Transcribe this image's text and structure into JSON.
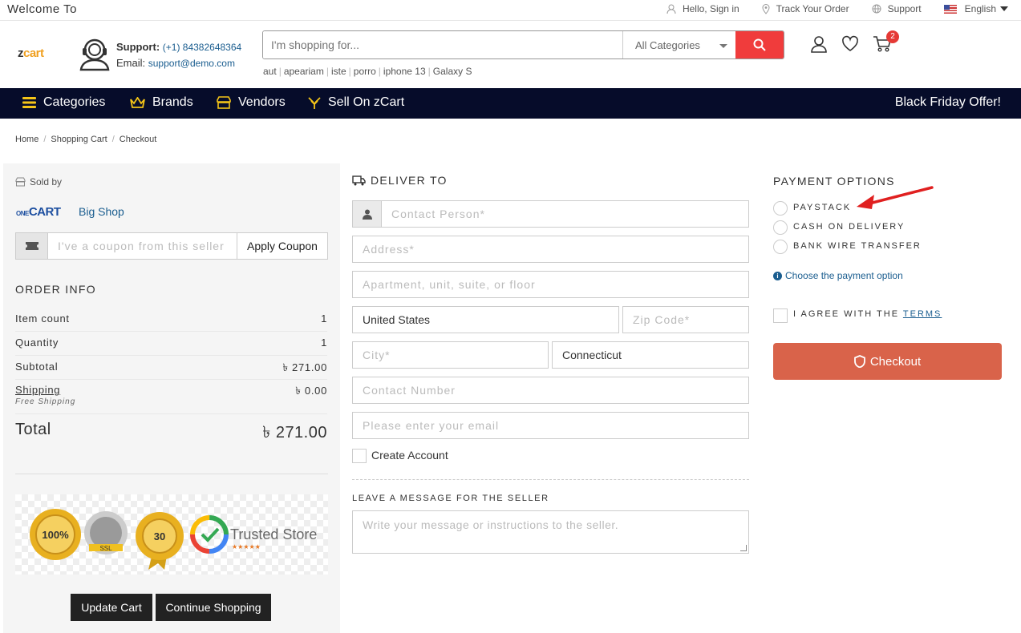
{
  "topbar": {
    "welcome": "Welcome To",
    "links": [
      "Hello, Sign in",
      "Track Your Order",
      "Support"
    ],
    "language": "English"
  },
  "header": {
    "logo_prefix": "z",
    "logo_suffix": "cart",
    "support_label": "Support:",
    "support_phone": "(+1) 84382648364",
    "email_label": "Email:",
    "email": "support@demo.com",
    "search_placeholder": "I'm shopping for...",
    "search_category": "All Categories",
    "search_tags": [
      "aut",
      "apeariam",
      "iste",
      "porro",
      "iphone 13",
      "Galaxy S"
    ],
    "cart_count": "2"
  },
  "nav": {
    "items": [
      "Categories",
      "Brands",
      "Vendors",
      "Sell On zCart"
    ],
    "offer": "Black Friday Offer!"
  },
  "breadcrumb": [
    "Home",
    "Shopping Cart",
    "Checkout"
  ],
  "cart": {
    "sold_by": "Sold by",
    "shop_logo_prefix": "ONE",
    "shop_logo_suffix": "CART",
    "shop_name": "Big Shop",
    "coupon_placeholder": "I've a coupon from this seller",
    "apply_coupon": "Apply Coupon",
    "order_info_title": "ORDER INFO",
    "rows": {
      "item_count_label": "Item count",
      "item_count": "1",
      "quantity_label": "Quantity",
      "quantity": "1",
      "subtotal_label": "Subtotal",
      "subtotal": "৳ 271.00",
      "shipping_label": "Shipping",
      "shipping": "৳ 0.00",
      "shipping_note": "Free Shipping"
    },
    "total_label": "Total",
    "total": "৳ 271.00",
    "trusted_store": "Trusted Store",
    "update_cart": "Update Cart",
    "continue_shopping": "Continue Shopping"
  },
  "deliver": {
    "title": "DELIVER TO",
    "contact_person": "Contact Person*",
    "address": "Address*",
    "apartment": "Apartment, unit, suite, or floor",
    "country": "United States",
    "zip": "Zip Code*",
    "city": "City*",
    "state": "Connecticut",
    "contact_number": "Contact Number",
    "email": "Please enter your email",
    "create_account": "Create Account",
    "message_title": "LEAVE A MESSAGE FOR THE SELLER",
    "message_placeholder": "Write your message or instructions to the seller."
  },
  "payment": {
    "title": "PAYMENT OPTIONS",
    "options": [
      "PAYSTACK",
      "CASH ON DELIVERY",
      "BANK WIRE TRANSFER"
    ],
    "hint": "Choose the payment option",
    "agree_prefix": "I AGREE WITH THE",
    "terms": "TERMS",
    "checkout": "Checkout"
  },
  "colors": {
    "nav_bg": "#060c2a",
    "checkout": "#d9634a",
    "search_btn": "#f03c3c",
    "link": "#1a5d8f",
    "annotation_arrow": "#e02020"
  }
}
